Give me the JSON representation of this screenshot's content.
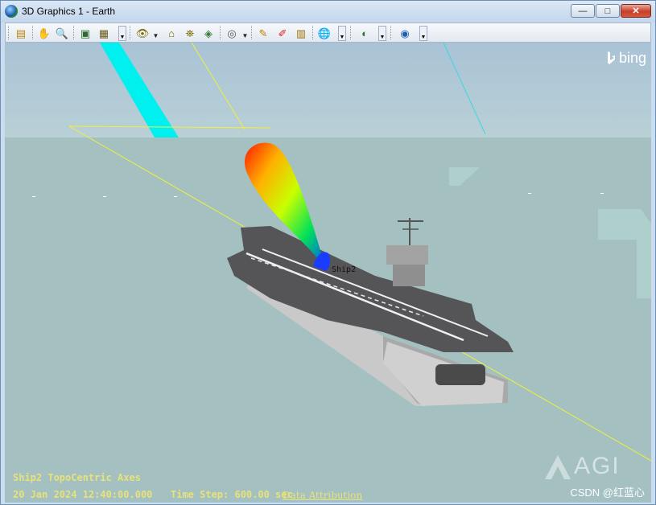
{
  "window": {
    "title": "3D Graphics 1 - Earth",
    "minimize_glyph": "—",
    "maximize_glyph": "□",
    "close_glyph": "✕"
  },
  "toolbar": {
    "buttons": [
      {
        "name": "properties-icon",
        "glyph": "▤"
      },
      {
        "name": "pan-hand-icon",
        "glyph": "✋"
      },
      {
        "name": "zoom-icon",
        "glyph": "🔍"
      },
      {
        "name": "snapshot-icon",
        "glyph": "▣"
      },
      {
        "name": "record-icon",
        "glyph": "▦"
      },
      {
        "name": "view-from-to-icon",
        "glyph": "👁"
      },
      {
        "name": "home-view-icon",
        "glyph": "⌂"
      },
      {
        "name": "view-object-icon",
        "glyph": "⛯"
      },
      {
        "name": "orbit-view-icon",
        "glyph": "◈"
      },
      {
        "name": "stored-views-icon",
        "glyph": "◎"
      },
      {
        "name": "measure-pen-icon",
        "glyph": "✎"
      },
      {
        "name": "annotate-pen-icon",
        "glyph": "✐"
      },
      {
        "name": "ruler-icon",
        "glyph": "▥"
      },
      {
        "name": "globe-manager-icon",
        "glyph": "🌐"
      },
      {
        "name": "map-layers-icon",
        "glyph": "◐"
      },
      {
        "name": "earth-imagery-icon",
        "glyph": "◉"
      }
    ]
  },
  "overlay": {
    "axes_label": "Ship2 TopoCentric Axes",
    "datetime": "20 Jan 2024 12:40:00.000",
    "time_step": "Time Step: 600.00 sec",
    "data_attribution": "Data Attribution",
    "ship_label": "Ship2",
    "bing_logo": "bing",
    "agi_logo": "AGI",
    "watermark": "CSDN @红蓝心"
  },
  "colors": {
    "sea": "#a4c0c1",
    "sky": "#b4cbd6",
    "overlay_text": "#e8e27a",
    "beam": "#00f0f0",
    "axes_line": "#f2ef3a"
  }
}
